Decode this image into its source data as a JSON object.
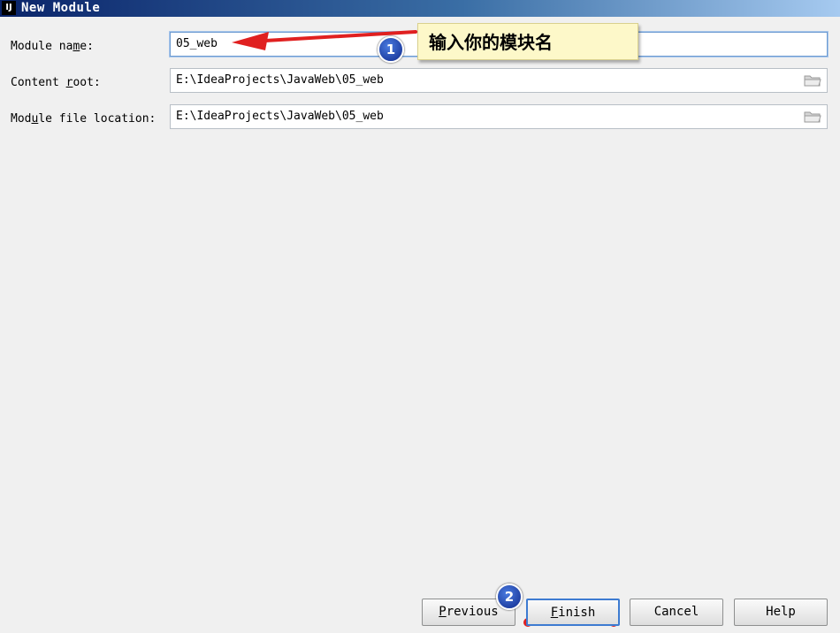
{
  "window": {
    "app_icon": "IJ",
    "title": "New Module"
  },
  "form": {
    "module_name": {
      "label_pre": "Module na",
      "label_mnemonic": "m",
      "label_post": "e:",
      "value": "05_web"
    },
    "content_root": {
      "label_pre": "Content ",
      "label_mnemonic": "r",
      "label_post": "oot:",
      "value": "E:\\IdeaProjects\\JavaWeb\\05_web",
      "browse_icon": "folder-icon"
    },
    "module_file_location": {
      "label_pre": "Mod",
      "label_mnemonic": "u",
      "label_post": "le file location:",
      "value": "E:\\IdeaProjects\\JavaWeb\\05_web",
      "browse_icon": "folder-icon"
    }
  },
  "annotations": {
    "callout_text": "输入你的模块名",
    "badge_1": "1",
    "badge_2": "2",
    "accent_red": "#e02020",
    "badge_blue": "#1a3fb0"
  },
  "buttons": {
    "previous": {
      "mnemonic": "P",
      "rest": "revious"
    },
    "finish": {
      "mnemonic": "F",
      "rest": "inish"
    },
    "cancel": {
      "label": "Cancel"
    },
    "help": {
      "label": "Help"
    }
  }
}
